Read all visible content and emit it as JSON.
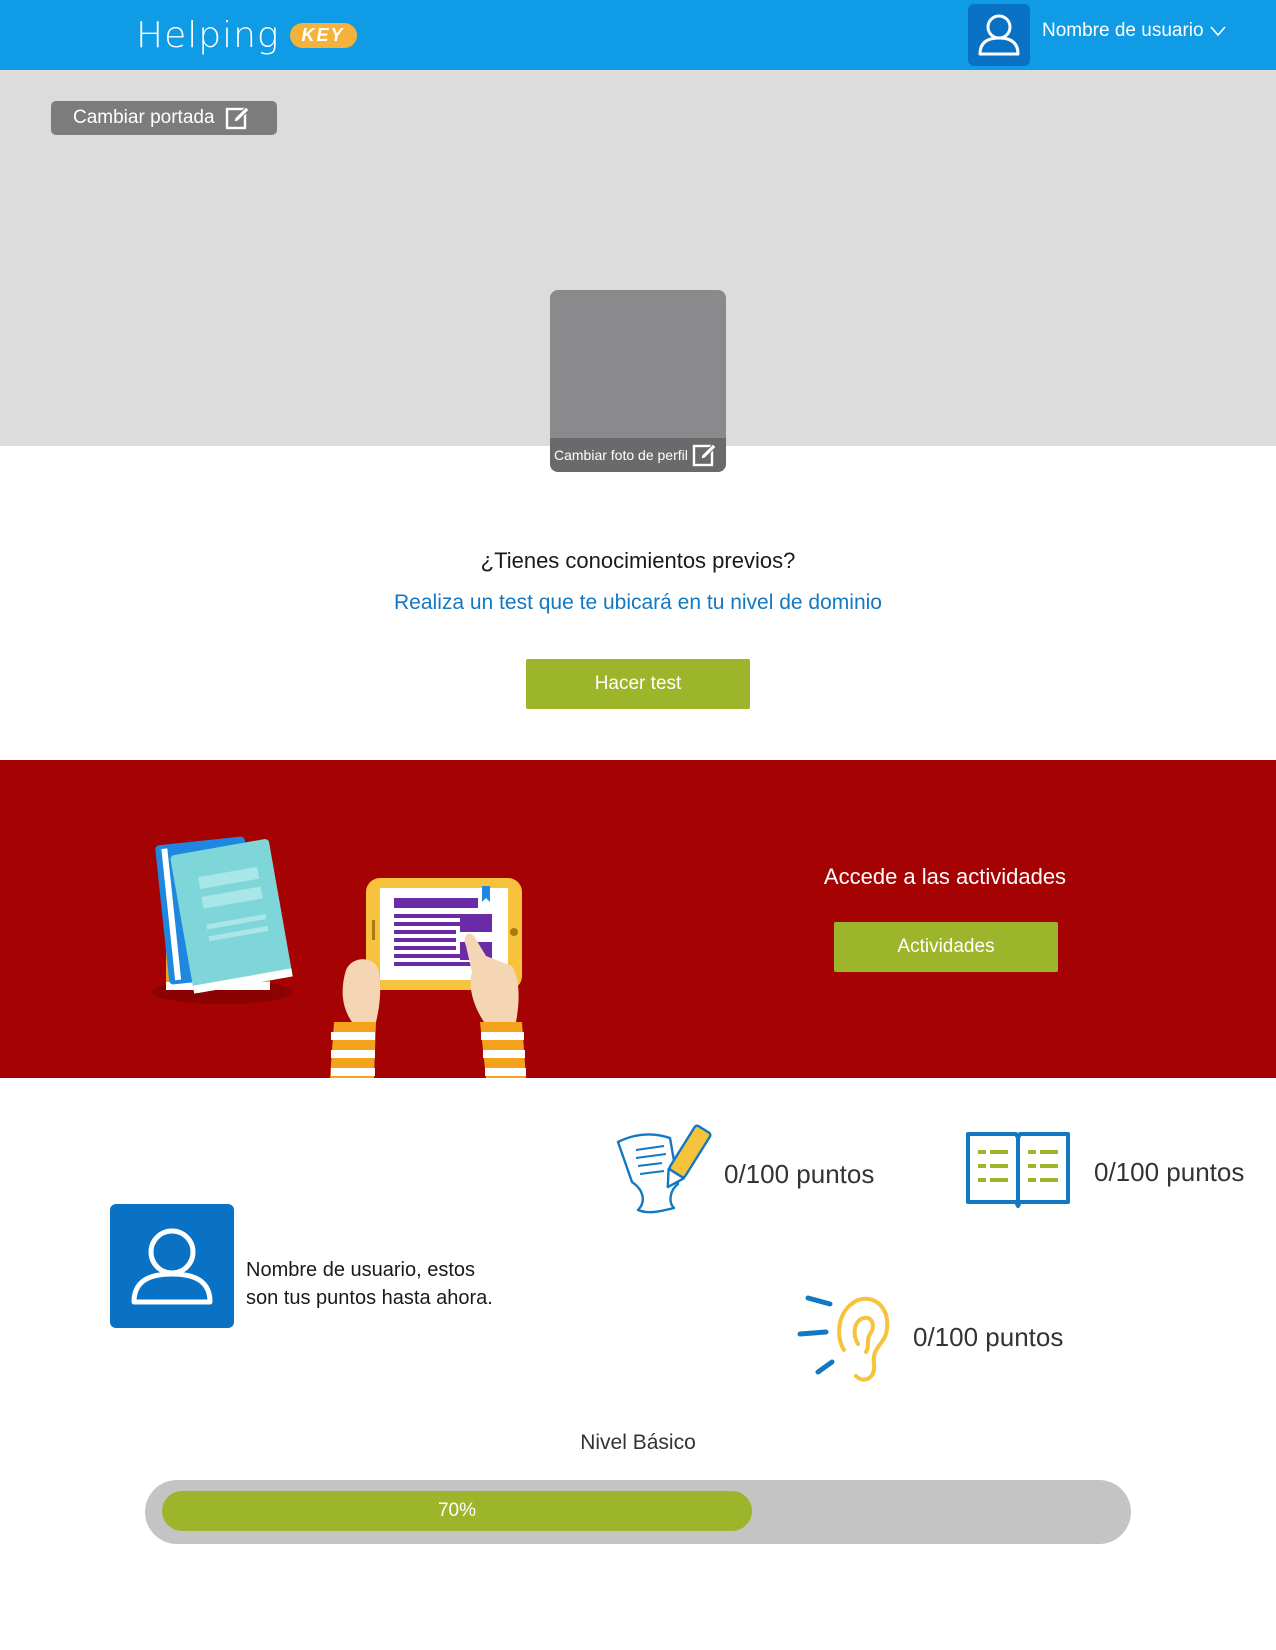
{
  "header": {
    "logo_text": "Helping",
    "logo_badge": "KEY",
    "user_name": "Nombre de usuario"
  },
  "cover": {
    "change_cover_label": "Cambiar portada",
    "change_photo_label": "Cambiar foto de perfil"
  },
  "test": {
    "question": "¿Tienes conocimientos previos?",
    "invite": "Realiza un test que te ubicará en tu nivel de dominio",
    "button_label": "Hacer test"
  },
  "activities": {
    "title": "Accede a las actividades",
    "button_label": "Actividades"
  },
  "points": {
    "message_line1": "Nombre de usuario, estos",
    "message_line2": "son tus puntos hasta ahora.",
    "writing": "0/100 puntos",
    "reading": "0/100 puntos",
    "listening": "0/100 puntos"
  },
  "level": {
    "label": "Nivel Básico",
    "progress_text": "70%",
    "progress_value": 0.62
  },
  "colors": {
    "header_blue": "#0f9be6",
    "accent_green": "#9db52a",
    "band_red": "#a50303",
    "link_blue": "#1378c2"
  },
  "icons": [
    "user-icon",
    "chevron-down-icon",
    "edit-icon",
    "writing-icon",
    "book-icon",
    "ear-icon"
  ]
}
